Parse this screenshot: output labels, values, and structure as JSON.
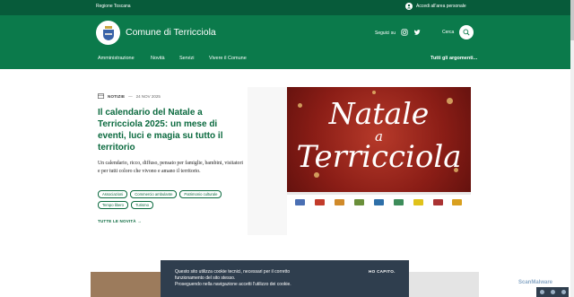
{
  "topbar": {
    "region": "Regione Toscana",
    "login_label": "Accedi all'area personale"
  },
  "header": {
    "site_title": "Comune di Terricciola",
    "social_label": "Seguici su",
    "search_label": "Cerca",
    "icons": [
      "user-icon",
      "instagram-icon",
      "twitter-icon",
      "search-icon"
    ]
  },
  "nav": {
    "items": [
      "Amministrazione",
      "Novità",
      "Servizi",
      "Vivere il Comune"
    ],
    "all_topics": "Tutti gli argomenti..."
  },
  "article": {
    "category": "NOTIZIE",
    "date": "24 NOV 2025",
    "title": "Il calendario del Natale a Terricciola 2025: un mese di eventi, luci e magia su tutto il territorio",
    "summary": "Un calendario, ricco, diffuso, pensato per famiglie, bambini, visitatori e per tutti coloro che vivono e amano il territorio.",
    "tags": [
      "Associazioni",
      "Commercio ambulante",
      "Patrimonio culturale",
      "Tempo libero",
      "Turismo"
    ],
    "all_news_label": "TUTTE LE NOVITÀ"
  },
  "poster": {
    "line1": "Natale",
    "line2": "a",
    "line3": "Terricciola"
  },
  "cookie": {
    "text_line1": "Questo sito utilizza cookie tecnici, necessari per il corretto",
    "text_line2": "funzionamento del sito stesso.",
    "text_line3": "Proseguendo nella navigazione accetti l'utilizzo dei cookie.",
    "accept_label": "HO CAPITO."
  },
  "watermark": "ScanMalware",
  "colors": {
    "top_bar": "#075b3a",
    "header": "#0b7a4b",
    "accent_text": "#0b6a3f",
    "cookie_banner": "#2f3e4e"
  }
}
